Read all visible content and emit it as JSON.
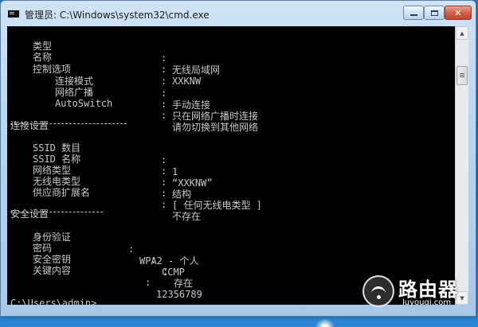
{
  "window": {
    "title": "管理员: C:\\Windows\\system32\\cmd.exe"
  },
  "console": {
    "lines": [
      {
        "id": "type",
        "label": "类型",
        "sep": ":",
        "value": "无线局域网"
      },
      {
        "id": "name",
        "label": "名称",
        "sep": ":",
        "value": "XXKNW"
      },
      {
        "id": "control",
        "label": "控制选项",
        "sep": ":",
        "value": ""
      },
      {
        "id": "connmode",
        "label": "连接模式",
        "sep": ":",
        "value": "手动连接"
      },
      {
        "id": "broadcast",
        "label": "网络广播",
        "sep": ":",
        "value": "只在网络广播时连接"
      },
      {
        "id": "autoswitch",
        "label": "AutoSwitch",
        "sep": ":",
        "value": "请勿切换到其他网络"
      },
      {
        "id": "conn-header",
        "label": "连接设置"
      },
      {
        "id": "ssid-count",
        "label": "SSID 数目",
        "sep": ":",
        "value": "1"
      },
      {
        "id": "ssid-name",
        "label": "SSID 名称",
        "sep": ":",
        "value": "“XXKNW”"
      },
      {
        "id": "net-type",
        "label": "网络类型",
        "sep": ":",
        "value": "结构"
      },
      {
        "id": "radio-type",
        "label": "无线电类型",
        "sep": ":",
        "value": "[ 任何无线电类型 ]"
      },
      {
        "id": "vendor-ext",
        "label": "供应商扩展名",
        "sep": ":",
        "value": "不存在"
      },
      {
        "id": "sec-header",
        "label": "安全设置"
      },
      {
        "id": "auth",
        "label": "身份验证",
        "sep": ":",
        "value": "WPA2 - 个人"
      },
      {
        "id": "cipher",
        "label": "密码",
        "sep": ":",
        "value": "CCMP"
      },
      {
        "id": "sec-key",
        "label": "安全密钥",
        "sep": ":",
        "value": "存在"
      },
      {
        "id": "key-content",
        "label": "关键内容",
        "sep": ":",
        "value": "12356789"
      }
    ],
    "prompt": "C:\\Users\\admin>"
  },
  "watermark": {
    "title": "路由器",
    "subtitle": "luyouqi.com"
  },
  "colors": {
    "console_bg": "#000000",
    "console_text": "#c8c8c8",
    "desktop": "#1a6cc0"
  }
}
